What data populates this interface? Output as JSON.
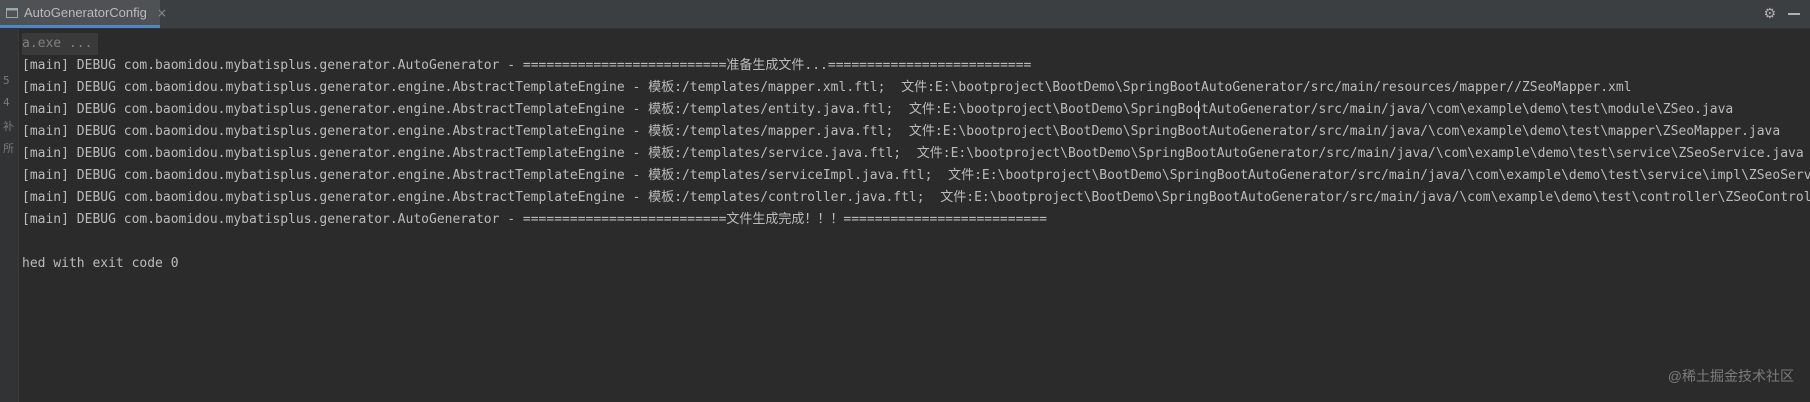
{
  "tab": {
    "title": "AutoGeneratorConfig",
    "close": "×",
    "icon": "console-icon"
  },
  "toolbar": {
    "settings_icon": "gear-icon",
    "minimize_icon": "minimize-icon"
  },
  "gutter": {
    "chars": [
      "5",
      "4",
      "补",
      "所"
    ]
  },
  "console": {
    "command": "a.exe ...",
    "lines": [
      "[main] DEBUG com.baomidou.mybatisplus.generator.AutoGenerator - ==========================准备生成文件...==========================",
      "[main] DEBUG com.baomidou.mybatisplus.generator.engine.AbstractTemplateEngine - 模板:/templates/mapper.xml.ftl;  文件:E:\\bootproject\\BootDemo\\SpringBootAutoGenerator/src/main/resources/mapper//ZSeoMapper.xml",
      "[main] DEBUG com.baomidou.mybatisplus.generator.engine.AbstractTemplateEngine - 模板:/templates/entity.java.ftl;  文件:E:\\bootproject\\BootDemo\\SpringBootAutoGenerator/src/main/java/\\com\\example\\demo\\test\\module\\ZSeo.java",
      "[main] DEBUG com.baomidou.mybatisplus.generator.engine.AbstractTemplateEngine - 模板:/templates/mapper.java.ftl;  文件:E:\\bootproject\\BootDemo\\SpringBootAutoGenerator/src/main/java/\\com\\example\\demo\\test\\mapper\\ZSeoMapper.java",
      "[main] DEBUG com.baomidou.mybatisplus.generator.engine.AbstractTemplateEngine - 模板:/templates/service.java.ftl;  文件:E:\\bootproject\\BootDemo\\SpringBootAutoGenerator/src/main/java/\\com\\example\\demo\\test\\service\\ZSeoService.java",
      "[main] DEBUG com.baomidou.mybatisplus.generator.engine.AbstractTemplateEngine - 模板:/templates/serviceImpl.java.ftl;  文件:E:\\bootproject\\BootDemo\\SpringBootAutoGenerator/src/main/java/\\com\\example\\demo\\test\\service\\impl\\ZSeoServiceImpl.java",
      "[main] DEBUG com.baomidou.mybatisplus.generator.engine.AbstractTemplateEngine - 模板:/templates/controller.java.ftl;  文件:E:\\bootproject\\BootDemo\\SpringBootAutoGenerator/src/main/java/\\com\\example\\demo\\test\\controller\\ZSeoController.java",
      "[main] DEBUG com.baomidou.mybatisplus.generator.AutoGenerator - ==========================文件生成完成！！！=========================="
    ],
    "exit": "hed with exit code 0"
  },
  "watermark": "@稀土掘金技术社区"
}
